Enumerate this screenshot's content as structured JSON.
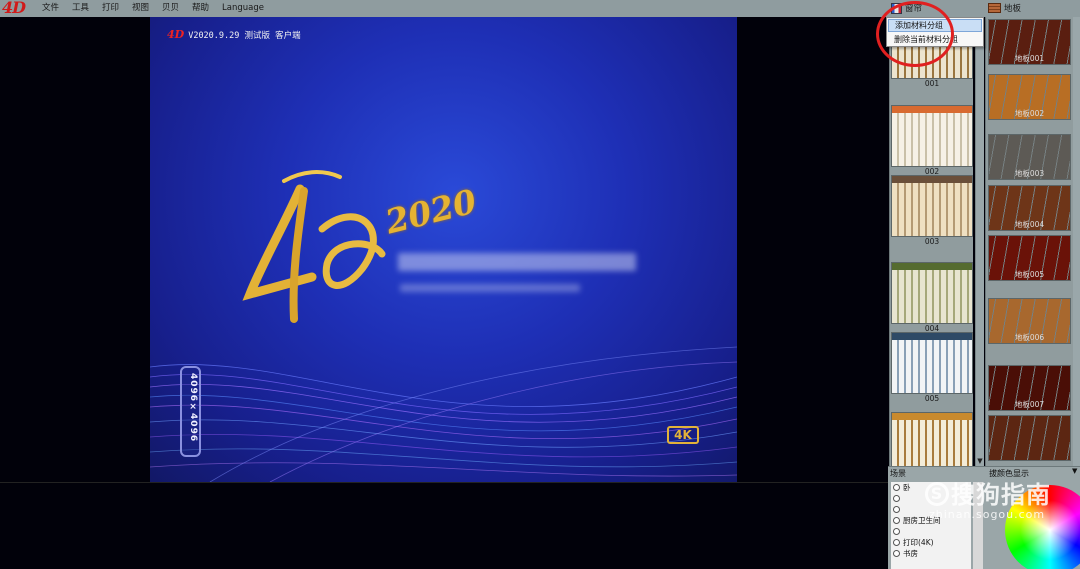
{
  "app": {
    "logo_text": "4D",
    "menu": [
      "文件",
      "工具",
      "打印",
      "视图",
      "贝贝",
      "帮助",
      "Language"
    ]
  },
  "tabs": {
    "curtain": "窗帘",
    "floor": "地板"
  },
  "context_menu": {
    "items": [
      "添加材料分组",
      "删除当前材料分组"
    ]
  },
  "splash": {
    "version_text": "V2020.9.29 测试版 客户端",
    "year_text": "2020",
    "resolution_text": "4096×4096",
    "badge_text": "4K",
    "mini_logo": "4D"
  },
  "curtains": {
    "items": [
      {
        "label": "001",
        "colors": [
          "#c8a46a",
          "#ece4cf",
          "#9a7640"
        ]
      },
      {
        "label": "002",
        "colors": [
          "#d86a30",
          "#f6f1e6",
          "#c9c0a8"
        ]
      },
      {
        "label": "003",
        "colors": [
          "#6a4f3a",
          "#efe0c2",
          "#b49a74"
        ]
      },
      {
        "label": "004",
        "colors": [
          "#556b2f",
          "#e8e5d0",
          "#a6a87a"
        ]
      },
      {
        "label": "005",
        "colors": [
          "#2e4a66",
          "#f2f4f6",
          "#8aa0b6"
        ]
      },
      {
        "label": "",
        "colors": [
          "#c98a2e",
          "#f3ecd8",
          "#a87b3c"
        ]
      }
    ]
  },
  "floors": {
    "items": [
      {
        "label": "地板001",
        "color": "#5a1e10"
      },
      {
        "label": "地板002",
        "color": "#b86e24"
      },
      {
        "label": "地板003",
        "color": "#5d5a55"
      },
      {
        "label": "地板004",
        "color": "#6e3518"
      },
      {
        "label": "地板005",
        "color": "#6a1208"
      },
      {
        "label": "地板006",
        "color": "#a8682e"
      },
      {
        "label": "地板007",
        "color": "#4a0e06"
      },
      {
        "label": "",
        "color": "#5c2612"
      }
    ]
  },
  "scene": {
    "title": "场景",
    "items": [
      "卧",
      "",
      "",
      "厨房卫生间",
      "",
      "打印(4K)",
      "书房"
    ]
  },
  "color_panel": {
    "title": "拔颜色显示"
  },
  "watermark": {
    "main": "搜狗指南",
    "sub": "zhinan.sogou.com",
    "s_glyph": "S"
  }
}
